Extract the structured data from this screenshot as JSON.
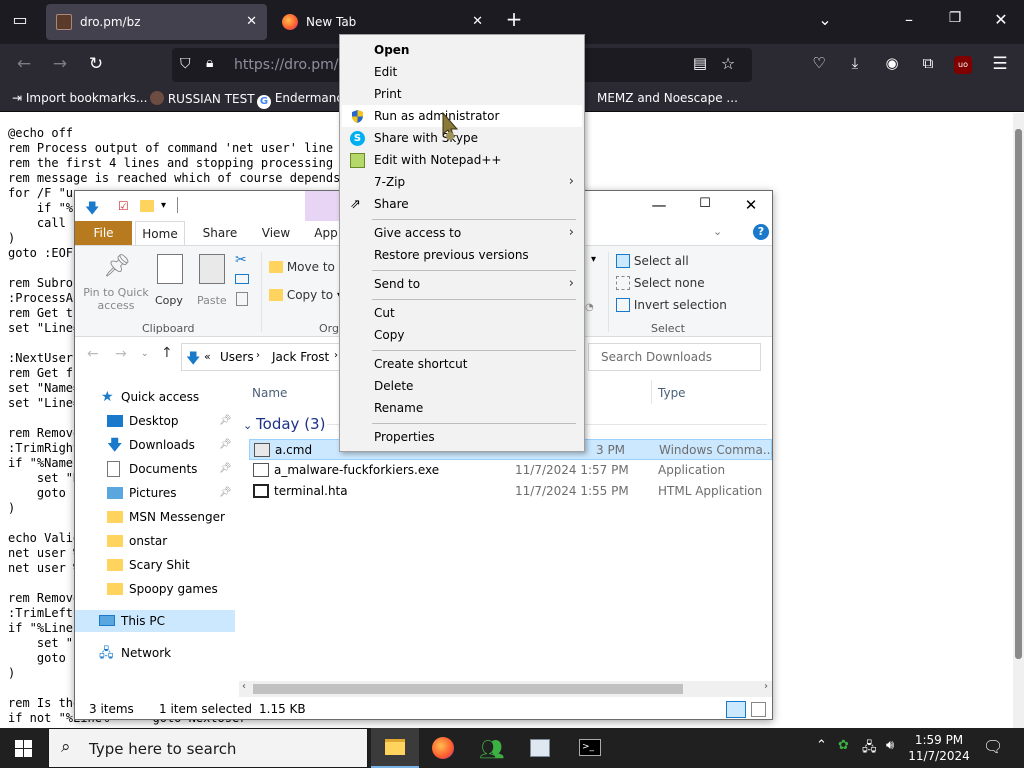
{
  "browser": {
    "tabs": [
      {
        "title": "dro.pm/bz",
        "active": true
      },
      {
        "title": "New Tab",
        "active": false
      }
    ],
    "url": "https://dro.pm/bz",
    "bookmarks": [
      "Import bookmarks...",
      "RUSSIAN TEST",
      "Endermanch",
      "MEMZ and Noescape ..."
    ],
    "extension_badge": "uo"
  },
  "page": {
    "lines": [
      "@echo off",
      "rem Process output of command 'net user' line by",
      "rem the first 4 lines and stopping processing wh",
      "rem message is reached which of course depends o",
      "for /F \"us",
      "    if \"%",
      "    call",
      ")",
      "goto :EOF",
      "",
      "rem Subrou",
      ":ProcessAc",
      "rem Get th",
      "set \"Line=",
      "",
      ":NextUser",
      "rem Get fi",
      "set \"Name=",
      "set \"Line=",
      "",
      "rem Remove",
      ":TrimRight",
      "if \"%Name",
      "    set \"N",
      "    goto",
      ")",
      "",
      "echo Valid",
      "net user %",
      "net user %",
      "",
      "rem Remove",
      ":TrimLeft",
      "if \"%Line",
      "    set \"",
      "    goto",
      ")",
      "",
      "rem Is the",
      "if not \"%Line%\"==\"\" goto NextUser"
    ]
  },
  "explorer": {
    "ribbon_tabs": [
      "File",
      "Home",
      "Share",
      "View",
      "App"
    ],
    "clipboard": {
      "pin": "Pin to Quick access",
      "copy": "Copy",
      "paste": "Paste",
      "group": "Clipboard"
    },
    "organize": {
      "move_to": "Move to",
      "copy_to": "Copy to",
      "group": "Org"
    },
    "select": {
      "select_all": "Select all",
      "select_none": "Select none",
      "invert": "Invert selection",
      "group": "Select"
    },
    "breadcrumb": [
      "Users",
      "Jack Frost"
    ],
    "search_placeholder": "Search Downloads",
    "columns": {
      "name": "Name",
      "type": "Type"
    },
    "group_header": "Today (3)",
    "nav": [
      {
        "label": "Quick access",
        "pinned": false,
        "icon": "star-icon"
      },
      {
        "label": "Desktop",
        "pinned": true,
        "icon": "desktop-icon"
      },
      {
        "label": "Downloads",
        "pinned": true,
        "icon": "download-icon"
      },
      {
        "label": "Documents",
        "pinned": true,
        "icon": "documents-icon"
      },
      {
        "label": "Pictures",
        "pinned": true,
        "icon": "pictures-icon"
      },
      {
        "label": "MSN Messenger",
        "pinned": false,
        "icon": "folder-icon"
      },
      {
        "label": "onstar",
        "pinned": false,
        "icon": "folder-icon"
      },
      {
        "label": "Scary Shit",
        "pinned": false,
        "icon": "folder-icon"
      },
      {
        "label": "Spoopy games",
        "pinned": false,
        "icon": "folder-icon"
      },
      {
        "label": "This PC",
        "pinned": false,
        "icon": "computer-icon"
      },
      {
        "label": "Network",
        "pinned": false,
        "icon": "network-icon"
      }
    ],
    "files": [
      {
        "name": "a.cmd",
        "date": "",
        "date_tail": "3 PM",
        "type": "Windows Comma..."
      },
      {
        "name": "a_malware-fuckforkiers.exe",
        "date": "11/7/2024 1:57 PM",
        "type": "Application"
      },
      {
        "name": "terminal.hta",
        "date": "11/7/2024 1:55 PM",
        "type": "HTML Application"
      }
    ],
    "status": {
      "count": "3 items",
      "selected": "1 item selected",
      "size": "1.15 KB"
    }
  },
  "context_menu": {
    "items": [
      {
        "label": "Open",
        "bold": true
      },
      {
        "label": "Edit"
      },
      {
        "label": "Print"
      },
      {
        "label": "Run as administrator",
        "icon": "shield-icon",
        "highlighted": true
      },
      {
        "label": "Share with Skype",
        "icon": "skype-icon"
      },
      {
        "label": "Edit with Notepad++",
        "icon": "notepadpp-icon"
      },
      {
        "label": "7-Zip",
        "submenu": true
      },
      {
        "label": "Share",
        "icon": "share-icon"
      },
      {
        "label": "Give access to",
        "submenu": true
      },
      {
        "label": "Restore previous versions"
      },
      {
        "label": "Send to",
        "submenu": true
      },
      {
        "label": "Cut"
      },
      {
        "label": "Copy"
      },
      {
        "label": "Create shortcut"
      },
      {
        "label": "Delete"
      },
      {
        "label": "Rename"
      },
      {
        "label": "Properties"
      }
    ]
  },
  "taskbar": {
    "search_placeholder": "Type here to search",
    "time": "1:59 PM",
    "date": "11/7/2024"
  }
}
